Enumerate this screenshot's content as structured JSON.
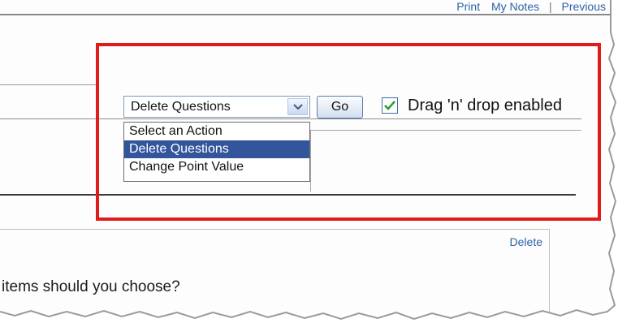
{
  "top_nav": {
    "print": "Print",
    "my_notes": "My Notes",
    "separator": "|",
    "previous": "Previous"
  },
  "toolbar": {
    "action_select": {
      "value": "Delete Questions",
      "options": [
        "Select an Action",
        "Delete Questions",
        "Change Point Value"
      ]
    },
    "go_label": "Go",
    "drag_drop": {
      "checked": true,
      "label": "Drag 'n' drop enabled"
    }
  },
  "question_panel": {
    "delete_label": "Delete",
    "text": "items should you choose?"
  },
  "colors": {
    "highlight": "#e01b1b",
    "link": "#2d62a8",
    "selected_option": "#32559c"
  }
}
